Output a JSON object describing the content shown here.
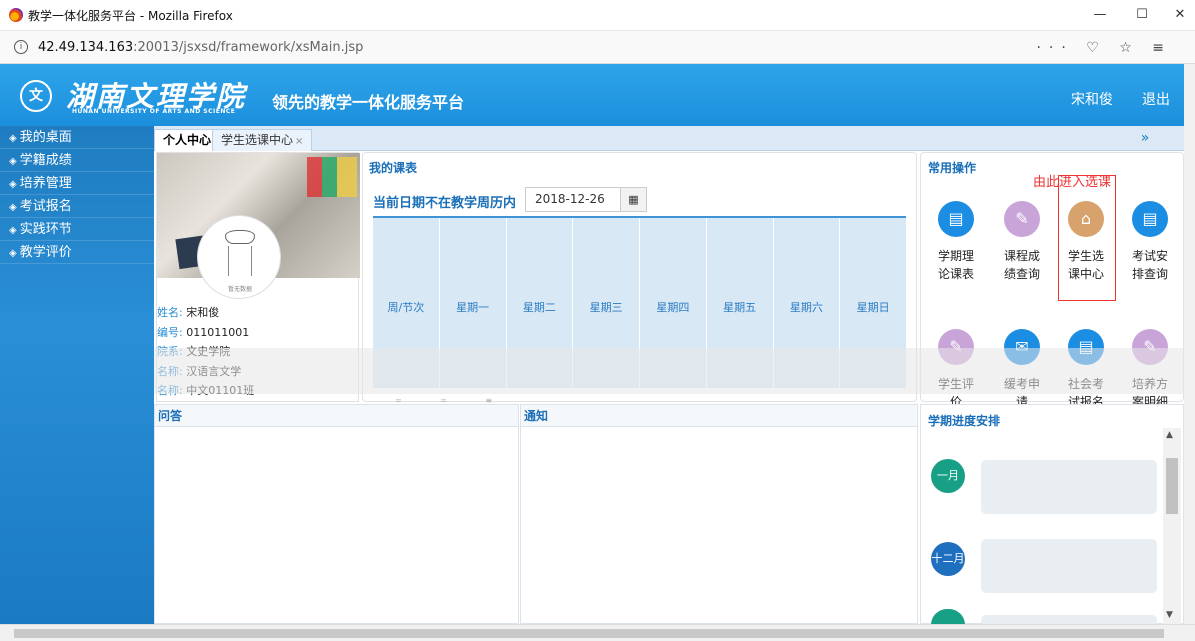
{
  "browser": {
    "window_title": "教学一体化服务平台 - Mozilla Firefox",
    "url_host": "42.49.134.163",
    "url_rest": ":20013/jsxsd/framework/xsMain.jsp",
    "nav_icons": "··· ♡ ☆ ≡"
  },
  "header": {
    "school_cn": "湖南文理学院",
    "school_en": "HUNAN UNIVERSITY OF ARTS AND SCIENCE",
    "platform": "领先的教学一体化服务平台",
    "user": "宋和俊",
    "logout": "退出"
  },
  "sidebar": {
    "items": [
      {
        "label": "我的桌面"
      },
      {
        "label": "学籍成绩"
      },
      {
        "label": "培养管理"
      },
      {
        "label": "考试报名"
      },
      {
        "label": "实践环节"
      },
      {
        "label": "教学评价"
      }
    ]
  },
  "tabs": [
    {
      "label": "个人中心"
    },
    {
      "label": "学生选课中心"
    }
  ],
  "profile": {
    "nodata": "暂无数据",
    "rows": [
      {
        "key": "姓名:",
        "value": "宋和俊"
      },
      {
        "key": "编号:",
        "value": "011011001"
      },
      {
        "key": "院系:",
        "value": "文史学院"
      },
      {
        "key": "名称:",
        "value": "汉语言文学"
      },
      {
        "key": "名称:",
        "value": "中文01101班"
      }
    ]
  },
  "schedule": {
    "title": "我的课表",
    "date_label": "当前日期不在教学周历内",
    "date_value": "2018-12-26",
    "columns": [
      "周/节次",
      "星期一",
      "星期二",
      "星期三",
      "星期四",
      "星期五",
      "星期六",
      "星期日"
    ]
  },
  "ops": {
    "title": "常用操作",
    "note": "由此进入选课",
    "items": [
      {
        "label": "学期理论课表",
        "icon": "chat-icon",
        "color": "#1b8ee4"
      },
      {
        "label": "课程成绩查询",
        "icon": "pen-icon",
        "color": "#c9a4d8"
      },
      {
        "label": "学生选课中心",
        "icon": "bank-icon",
        "color": "#d8a26d"
      },
      {
        "label": "考试安排查询",
        "icon": "chat-icon",
        "color": "#1b8ee4"
      },
      {
        "label": "学生评价",
        "icon": "pen-icon",
        "color": "#c9a4d8"
      },
      {
        "label": "缓考申请",
        "icon": "mail-icon",
        "color": "#1b8ee4"
      },
      {
        "label": "社会考试报名",
        "icon": "chat-icon",
        "color": "#1b8ee4"
      },
      {
        "label": "培养方案明细",
        "icon": "pen-icon",
        "color": "#c9a4d8"
      }
    ]
  },
  "panels": {
    "qa_title": "问答",
    "notice_title": "通知",
    "progress_title": "学期进度安排",
    "months": [
      {
        "label": "一月",
        "color": "#17a085"
      },
      {
        "label": "十二月",
        "color": "#1f6fbf"
      }
    ]
  }
}
